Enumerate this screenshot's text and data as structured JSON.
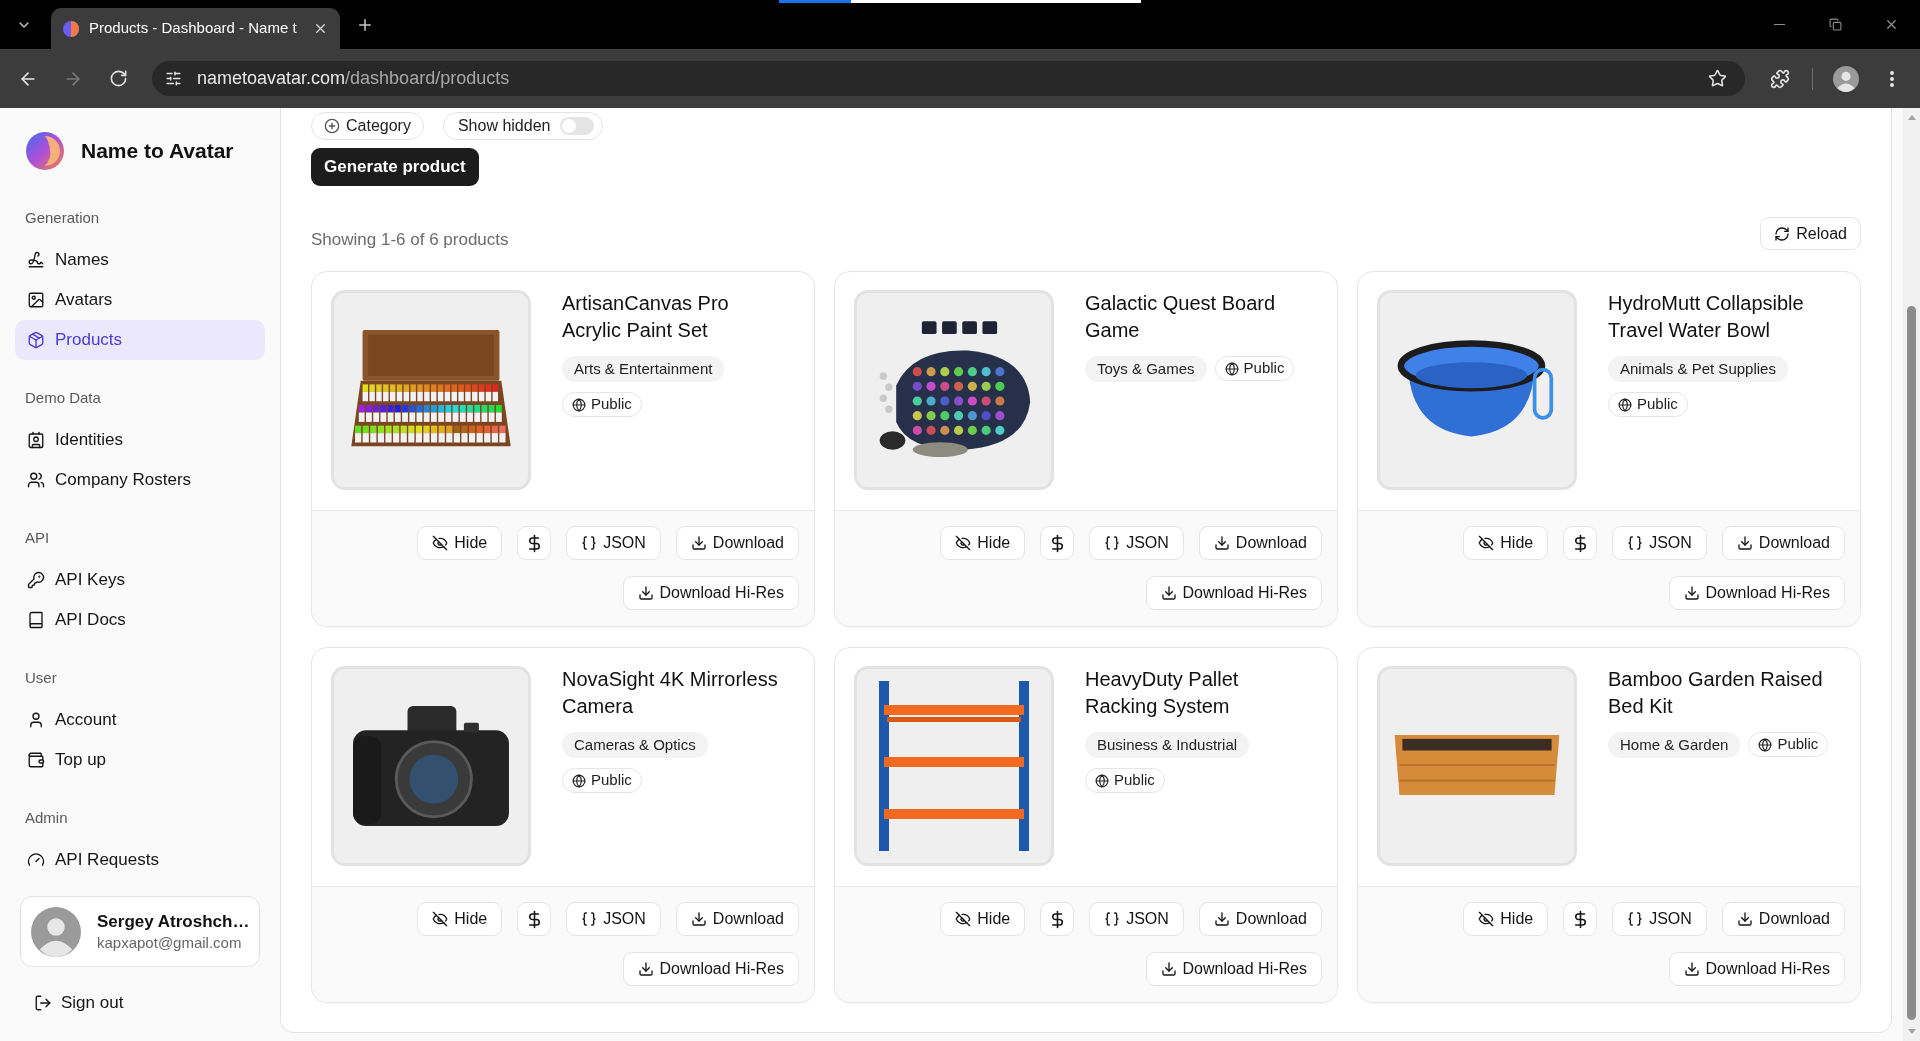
{
  "browser": {
    "tab": {
      "title": "Products - Dashboard - Name t",
      "selected": true
    },
    "progress": {
      "level": 0.2
    },
    "back_enabled": true,
    "forward_enabled": false,
    "url": {
      "host": "nametoavatar.com",
      "path": "/dashboard/products"
    }
  },
  "sidebar": {
    "brand": "Name to Avatar",
    "sections": [
      {
        "title": "Generation",
        "items": [
          {
            "label": "Names",
            "selected": false
          },
          {
            "label": "Avatars",
            "selected": false
          },
          {
            "label": "Products",
            "selected": true
          }
        ]
      },
      {
        "title": "Demo Data",
        "items": [
          {
            "label": "Identities",
            "selected": false
          },
          {
            "label": "Company Rosters",
            "selected": false
          }
        ]
      },
      {
        "title": "API",
        "items": [
          {
            "label": "API Keys",
            "selected": false
          },
          {
            "label": "API Docs",
            "selected": false
          }
        ]
      },
      {
        "title": "User",
        "items": [
          {
            "label": "Account",
            "selected": false
          },
          {
            "label": "Top up",
            "selected": false
          }
        ]
      },
      {
        "title": "Admin",
        "items": [
          {
            "label": "API Requests",
            "selected": false
          }
        ]
      }
    ],
    "user": {
      "name": "Sergey Atroshch…",
      "email": "kapxapot@gmail.com"
    },
    "sign_out": "Sign out"
  },
  "filters": [
    {
      "kind": "add",
      "label": "Category"
    },
    {
      "kind": "toggle",
      "label": "Show hidden",
      "on": false
    }
  ],
  "generate_button": "Generate product",
  "summary": "Showing 1-6 of 6 products",
  "reload_button": "Reload",
  "products": [
    {
      "title": "ArtisanCanvas Pro Acrylic Paint Set",
      "category": "Arts & Entertainment",
      "visibility": "Public",
      "actions": [
        {
          "kind": "hide",
          "label": "Hide"
        },
        {
          "kind": "price"
        },
        {
          "kind": "json",
          "label": "JSON"
        },
        {
          "kind": "download",
          "label": "Download"
        },
        {
          "kind": "download_hires",
          "label": "Download Hi-Res"
        }
      ]
    },
    {
      "title": "Galactic Quest Board Game",
      "category": "Toys & Games",
      "visibility": "Public",
      "actions": [
        {
          "kind": "hide",
          "label": "Hide"
        },
        {
          "kind": "price"
        },
        {
          "kind": "json",
          "label": "JSON"
        },
        {
          "kind": "download",
          "label": "Download"
        },
        {
          "kind": "download_hires",
          "label": "Download Hi-Res"
        }
      ]
    },
    {
      "title": "HydroMutt Collapsible Travel Water Bowl",
      "category": "Animals & Pet Supplies",
      "visibility": "Public",
      "actions": [
        {
          "kind": "hide",
          "label": "Hide"
        },
        {
          "kind": "price"
        },
        {
          "kind": "json",
          "label": "JSON"
        },
        {
          "kind": "download",
          "label": "Download"
        },
        {
          "kind": "download_hires",
          "label": "Download Hi-Res"
        }
      ]
    },
    {
      "title": "NovaSight 4K Mirrorless Camera",
      "category": "Cameras & Optics",
      "visibility": "Public",
      "actions": [
        {
          "kind": "hide",
          "label": "Hide"
        },
        {
          "kind": "price"
        },
        {
          "kind": "json",
          "label": "JSON"
        },
        {
          "kind": "download",
          "label": "Download"
        },
        {
          "kind": "download_hires",
          "label": "Download Hi-Res"
        }
      ]
    },
    {
      "title": "HeavyDuty Pallet Racking System",
      "category": "Business & Industrial",
      "visibility": "Public",
      "actions": [
        {
          "kind": "hide",
          "label": "Hide"
        },
        {
          "kind": "price"
        },
        {
          "kind": "json",
          "label": "JSON"
        },
        {
          "kind": "download",
          "label": "Download"
        },
        {
          "kind": "download_hires",
          "label": "Download Hi-Res"
        }
      ]
    },
    {
      "title": "Bamboo Garden Raised Bed Kit",
      "category": "Home & Garden",
      "visibility": "Public",
      "actions": [
        {
          "kind": "hide",
          "label": "Hide"
        },
        {
          "kind": "price"
        },
        {
          "kind": "json",
          "label": "JSON"
        },
        {
          "kind": "download",
          "label": "Download"
        },
        {
          "kind": "download_hires",
          "label": "Download Hi-Res"
        }
      ]
    }
  ]
}
